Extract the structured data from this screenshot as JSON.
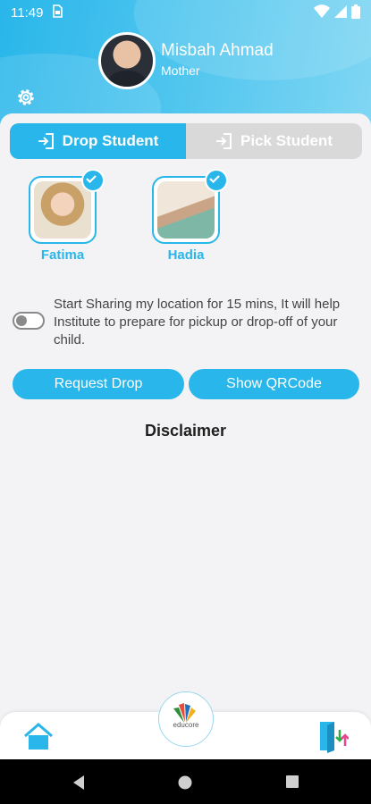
{
  "status_bar": {
    "time": "11:49",
    "sim_icon": "sim-card-icon",
    "icons": [
      "wifi-icon",
      "signal-icon",
      "battery-icon"
    ]
  },
  "profile": {
    "name": "Misbah Ahmad",
    "role": "Mother"
  },
  "tabs": [
    {
      "label": "Drop Student",
      "active": true
    },
    {
      "label": "Pick Student",
      "active": false
    }
  ],
  "children": [
    {
      "name": "Fatima",
      "selected": true
    },
    {
      "name": "Hadia",
      "selected": true
    }
  ],
  "location_sharing": {
    "enabled": false,
    "text": "Start Sharing my location for 15 mins, It will help Institute to prepare for pickup or drop-off of your child."
  },
  "buttons": {
    "request": "Request Drop",
    "qr": "Show QRCode"
  },
  "disclaimer": "Disclaimer",
  "logo_text": "educore",
  "colors": {
    "accent": "#29b6ea",
    "header_light": "#7fd6f3",
    "background": "#f1f1f3"
  }
}
